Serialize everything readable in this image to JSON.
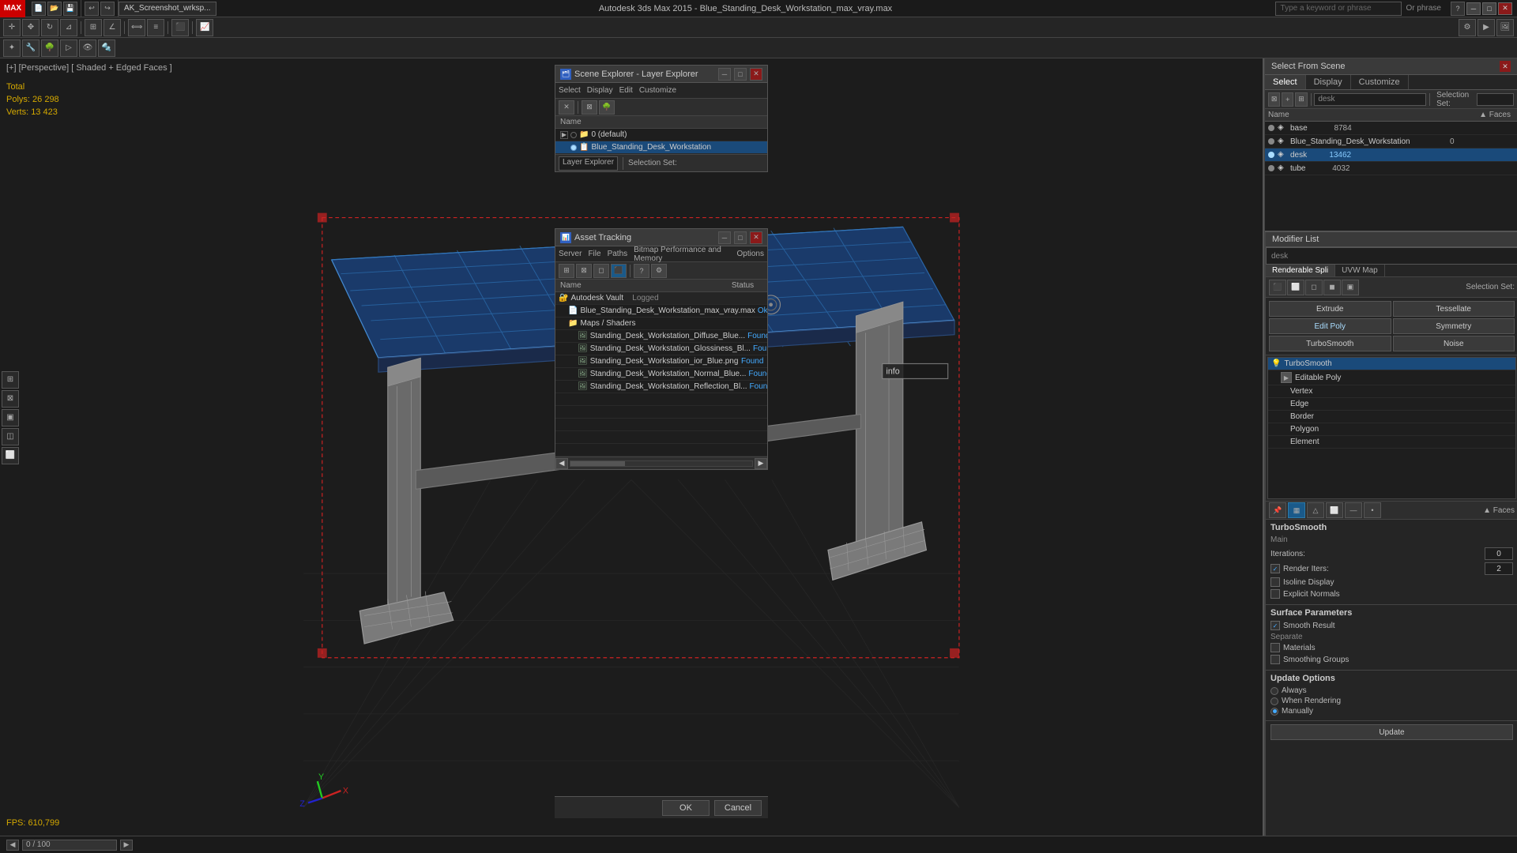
{
  "app": {
    "title": "Autodesk 3ds Max 2015  -  Blue_Standing_Desk_Workstation_max_vray.max",
    "search_placeholder": "Type a keyword or phrase",
    "search_hint": "Or phrase"
  },
  "viewport": {
    "label": "[+] [Perspective] [ Shaded + Edged Faces ]",
    "stats_label": "Total",
    "polys_label": "Polys:",
    "polys_value": "26 298",
    "verts_label": "Verts:",
    "verts_value": "13 423",
    "fps_label": "FPS:",
    "fps_value": "610,799"
  },
  "scene_explorer": {
    "title": "Scene Explorer - Layer Explorer",
    "menu": [
      "Select",
      "Display",
      "Edit",
      "Customize"
    ],
    "column_name": "Name",
    "rows": [
      {
        "id": "row1",
        "name": "0 (default)",
        "indent": 0,
        "expanded": true,
        "active": false
      },
      {
        "id": "row2",
        "name": "Blue_Standing_Desk_Workstation",
        "indent": 1,
        "active": true,
        "selected": true
      }
    ],
    "bottom_dropdown": "Layer Explorer",
    "selection_set": "Selection Set:"
  },
  "select_scene": {
    "title": "Select From Scene",
    "search_placeholder": "desk",
    "tabs": [
      "Select",
      "Display",
      "Customize"
    ],
    "column_name": "Name",
    "column_faces": "▲ Faces",
    "rows": [
      {
        "name": "base",
        "faces": "8784",
        "selected": false
      },
      {
        "name": "Blue_Standing_Desk_Workstation",
        "faces": "0",
        "selected": false
      },
      {
        "name": "desk",
        "faces": "13462",
        "selected": true
      },
      {
        "name": "tube",
        "faces": "4032",
        "selected": false
      }
    ],
    "selection_set_label": "Selection Set:",
    "ok_label": "OK",
    "cancel_label": "Cancel"
  },
  "asset_tracking": {
    "title": "Asset Tracking",
    "menu": [
      "Server",
      "File",
      "Paths",
      "Bitmap Performance and Memory",
      "Options"
    ],
    "column_name": "Name",
    "column_status": "Status",
    "rows": [
      {
        "name": "Autodesk Vault",
        "type": "vault",
        "indent": 0,
        "status": "Logged"
      },
      {
        "name": "Blue_Standing_Desk_Workstation_max_vray.max",
        "type": "file",
        "indent": 1,
        "status": "Ok"
      },
      {
        "name": "Maps / Shaders",
        "type": "folder",
        "indent": 1,
        "status": ""
      },
      {
        "name": "Standing_Desk_Workstation_Diffuse_Blue...",
        "type": "image",
        "indent": 2,
        "status": "Found"
      },
      {
        "name": "Standing_Desk_Workstation_Glossiness_Bl...",
        "type": "image",
        "indent": 2,
        "status": "Found"
      },
      {
        "name": "Standing_Desk_Workstation_ior_Blue.png",
        "type": "image",
        "indent": 2,
        "status": "Found"
      },
      {
        "name": "Standing_Desk_Workstation_Normal_Blue...",
        "type": "image",
        "indent": 2,
        "status": "Found"
      },
      {
        "name": "Standing_Desk_Workstation_Reflection_Bl...",
        "type": "image",
        "indent": 2,
        "status": "Found"
      }
    ]
  },
  "modifier": {
    "list_label": "Modifier List",
    "search_value": "desk",
    "tabs": [
      "Renderable Spli",
      "UVW Map"
    ],
    "quick_buttons": [
      "Extrude",
      "Tessellate",
      "Edit Poly",
      "Symmetry",
      "TurboSmooth",
      "Noise"
    ],
    "modifier_tree": [
      {
        "name": "TurboSmooth",
        "indent": 0,
        "highlight": true,
        "icon": "bulb"
      },
      {
        "name": "Editable Poly",
        "indent": 1,
        "icon": "expand"
      },
      {
        "name": "Vertex",
        "indent": 2
      },
      {
        "name": "Edge",
        "indent": 2
      },
      {
        "name": "Border",
        "indent": 2
      },
      {
        "name": "Polygon",
        "indent": 2
      },
      {
        "name": "Element",
        "indent": 2
      }
    ],
    "turbosmooth": {
      "section_label": "TurboSmooth",
      "main_label": "Main",
      "iterations_label": "Iterations:",
      "iterations_value": "0",
      "render_iters_label": "Render Iters:",
      "render_iters_value": "2",
      "render_iters_checked": true,
      "isoline_label": "Isoline Display",
      "explicit_label": "Explicit Normals",
      "surface_label": "Surface Parameters",
      "smooth_result_label": "Smooth Result",
      "smooth_result_checked": true,
      "separate_label": "Separate",
      "materials_label": "Materials",
      "materials_checked": false,
      "smoothing_label": "Smoothing Groups",
      "smoothing_checked": false,
      "update_label": "Update Options",
      "always_label": "Always",
      "when_rendering_label": "When Rendering",
      "manually_label": "Manually",
      "manually_selected": true,
      "update_btn": "Update"
    }
  },
  "bottom_bar": {
    "progress": "0 / 100"
  }
}
